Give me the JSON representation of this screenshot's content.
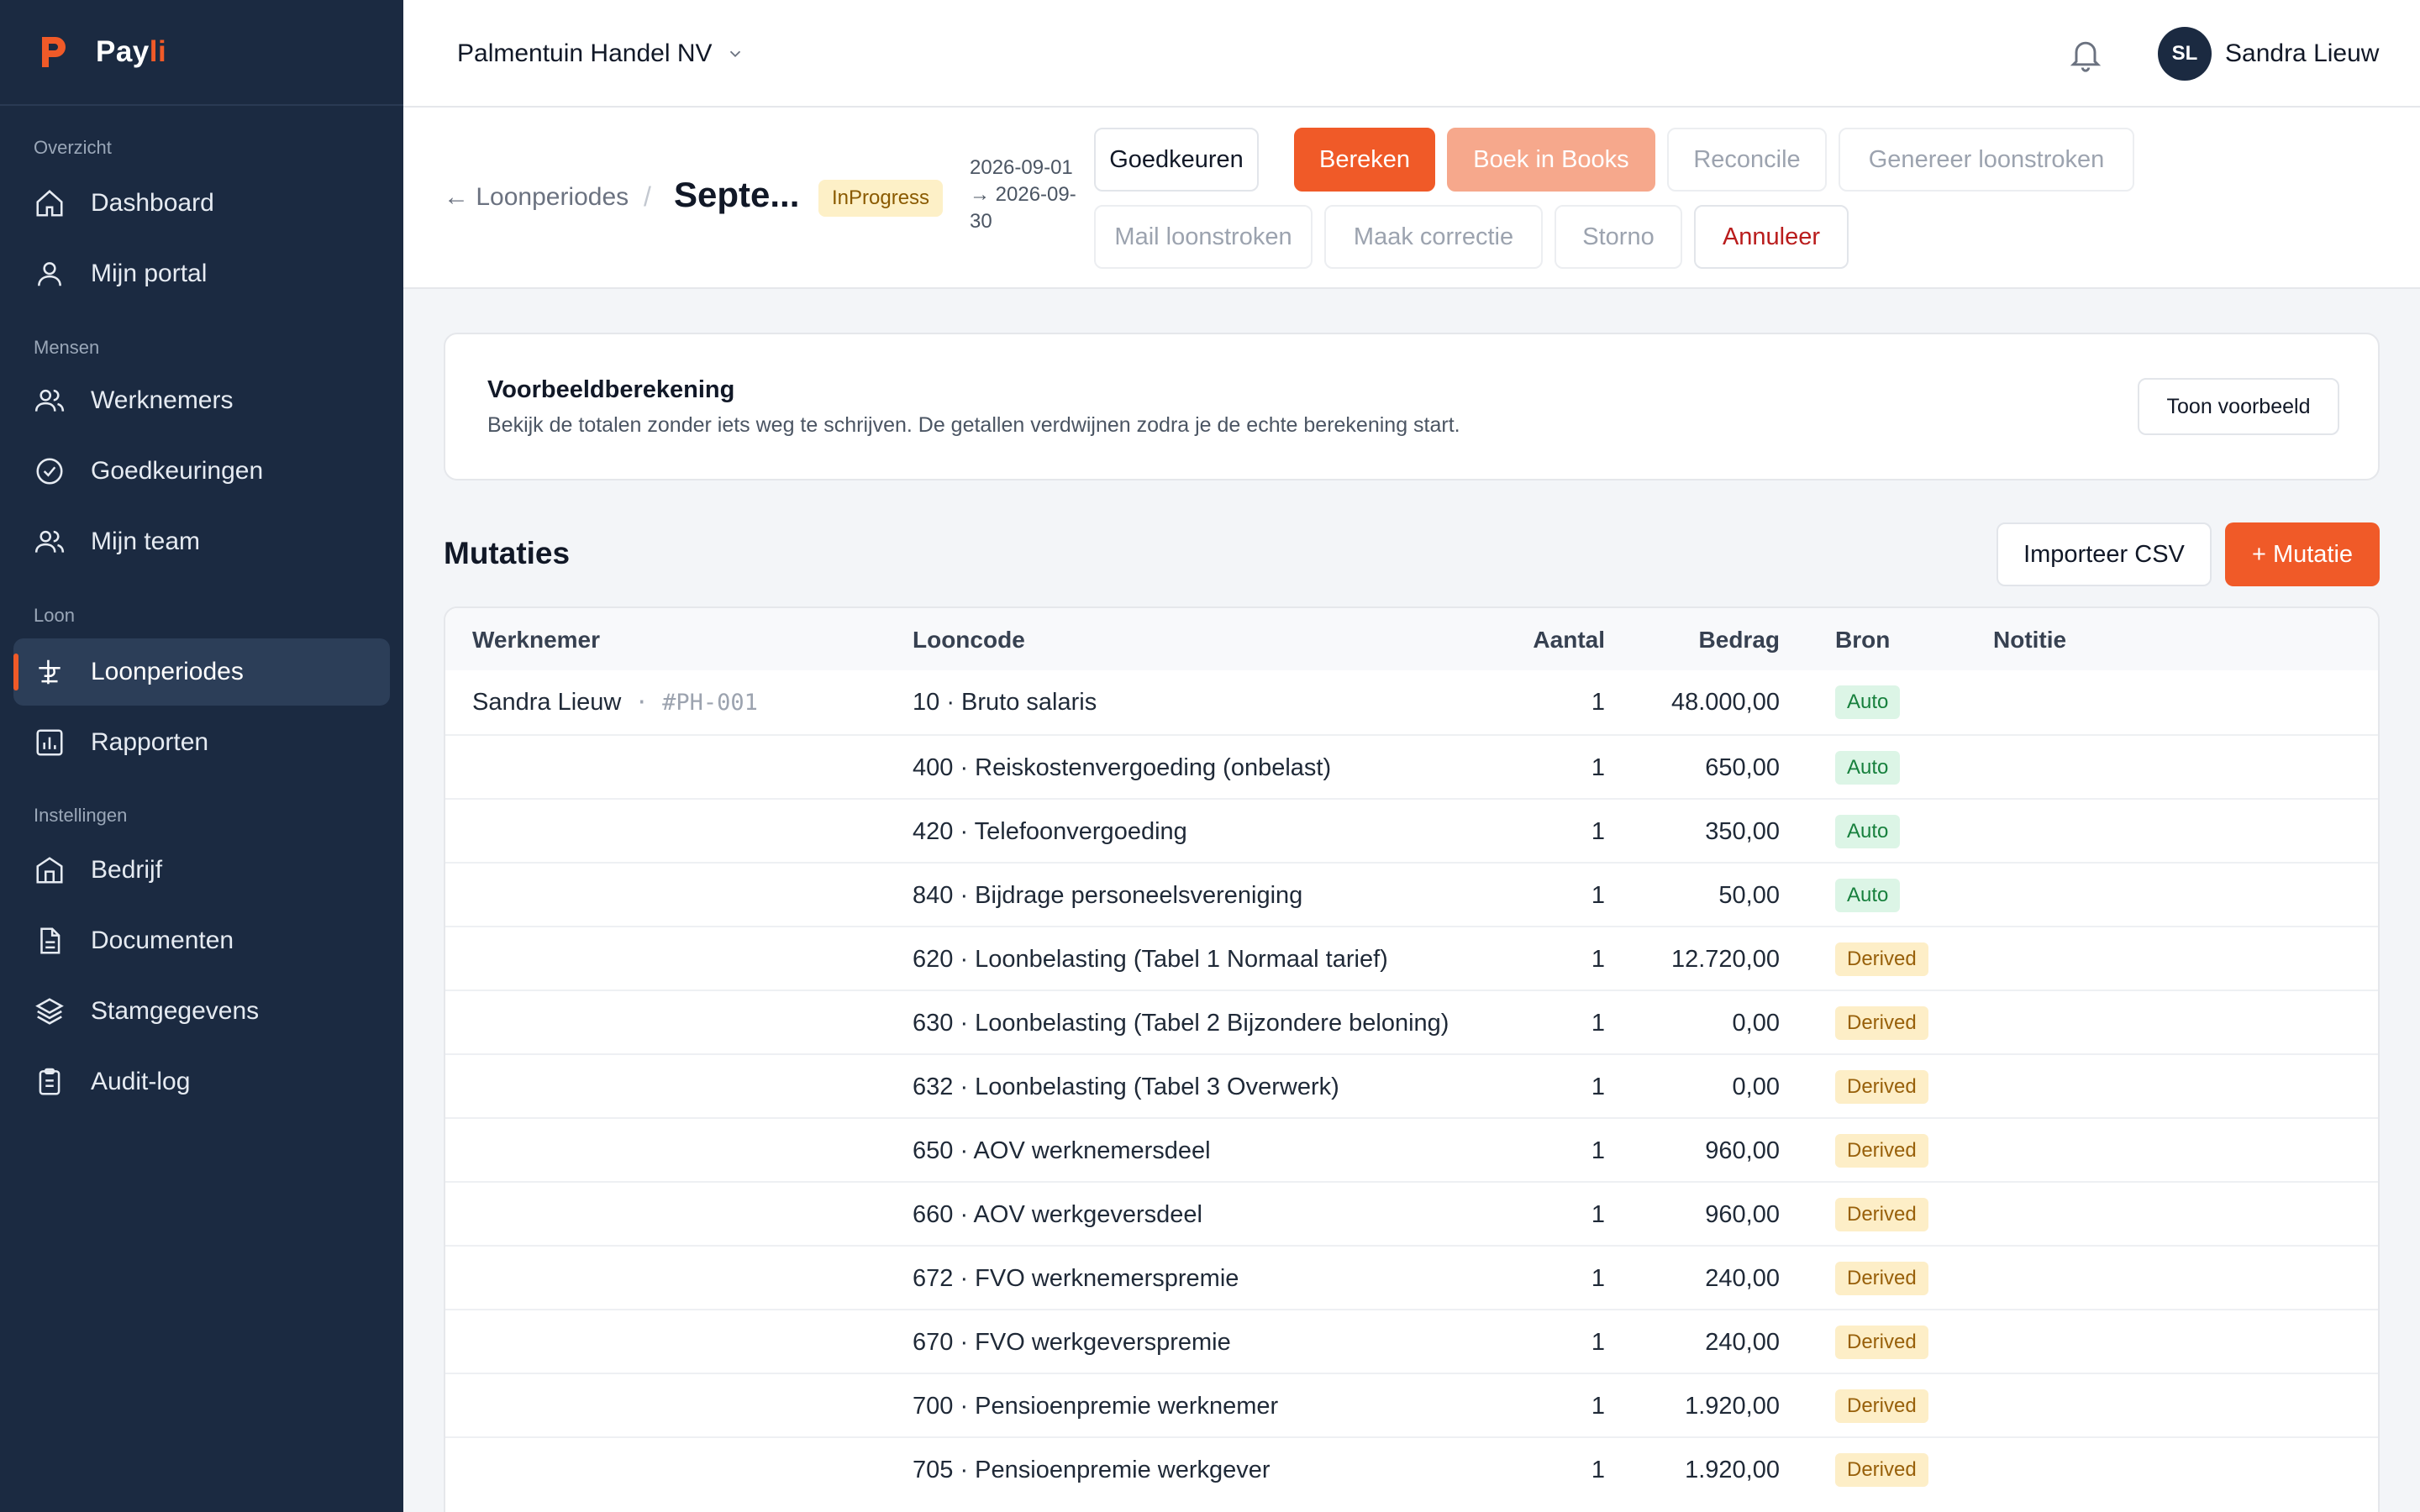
{
  "brand": {
    "name_main": "Pay",
    "name_accent": "li"
  },
  "sidebar": {
    "sections": [
      {
        "label": "Overzicht"
      },
      {
        "label": "Mensen"
      },
      {
        "label": "Loon"
      },
      {
        "label": "Instellingen"
      }
    ],
    "items": [
      {
        "label": "Dashboard",
        "icon": "home-icon"
      },
      {
        "label": "Mijn portal",
        "icon": "user-icon"
      },
      {
        "label": "Werknemers",
        "icon": "users-icon"
      },
      {
        "label": "Goedkeuringen",
        "icon": "check-circle-icon"
      },
      {
        "label": "Mijn team",
        "icon": "users-icon"
      },
      {
        "label": "Loonperiodes",
        "icon": "currency-icon",
        "active": true
      },
      {
        "label": "Rapporten",
        "icon": "bar-chart-icon"
      },
      {
        "label": "Bedrijf",
        "icon": "building-icon"
      },
      {
        "label": "Documenten",
        "icon": "document-icon"
      },
      {
        "label": "Stamgegevens",
        "icon": "layers-icon"
      },
      {
        "label": "Audit-log",
        "icon": "clipboard-icon"
      }
    ]
  },
  "topbar": {
    "org_name": "Palmentuin Handel NV",
    "user_initials": "SL",
    "user_name": "Sandra Lieuw"
  },
  "header": {
    "back_label": "← Loonperiodes",
    "separator": "/",
    "title": "Septe...",
    "status": "InProgress",
    "period_line1": "2026-09-01",
    "period_line2": "→ 2026-09-",
    "period_line3": "30",
    "actions": {
      "approve": "Goedkeuren",
      "calculate": "Bereken",
      "book": "Boek in Books",
      "reconcile": "Reconcile",
      "generate": "Genereer loonstroken",
      "mail": "Mail loonstroken",
      "correction": "Maak correctie",
      "storno": "Storno",
      "cancel": "Annuleer"
    }
  },
  "preview": {
    "title": "Voorbeeldberekening",
    "description": "Bekijk de totalen zonder iets weg te schrijven. De getallen verdwijnen zodra je de echte berekening start.",
    "button": "Toon voorbeeld"
  },
  "mutations": {
    "title": "Mutaties",
    "import_label": "Importeer CSV",
    "add_label": "+ Mutatie",
    "columns": {
      "employee": "Werknemer",
      "code": "Looncode",
      "qty": "Aantal",
      "amount": "Bedrag",
      "source": "Bron",
      "note": "Notitie"
    },
    "rows": [
      {
        "employee": "Sandra Lieuw",
        "employee_id": " · #PH-001",
        "code": "10 · Bruto salaris",
        "qty": "1",
        "amount": "48.000,00",
        "source": "Auto"
      },
      {
        "employee": "",
        "employee_id": "",
        "code": "400 · Reiskostenvergoeding (onbelast)",
        "qty": "1",
        "amount": "650,00",
        "source": "Auto"
      },
      {
        "employee": "",
        "employee_id": "",
        "code": "420 · Telefoonvergoeding",
        "qty": "1",
        "amount": "350,00",
        "source": "Auto"
      },
      {
        "employee": "",
        "employee_id": "",
        "code": "840 · Bijdrage personeelsvereniging",
        "qty": "1",
        "amount": "50,00",
        "source": "Auto"
      },
      {
        "employee": "",
        "employee_id": "",
        "code": "620 · Loonbelasting (Tabel 1 Normaal tarief)",
        "qty": "1",
        "amount": "12.720,00",
        "source": "Derived"
      },
      {
        "employee": "",
        "employee_id": "",
        "code": "630 · Loonbelasting (Tabel 2 Bijzondere beloning)",
        "qty": "1",
        "amount": "0,00",
        "source": "Derived"
      },
      {
        "employee": "",
        "employee_id": "",
        "code": "632 · Loonbelasting (Tabel 3 Overwerk)",
        "qty": "1",
        "amount": "0,00",
        "source": "Derived"
      },
      {
        "employee": "",
        "employee_id": "",
        "code": "650 · AOV werknemersdeel",
        "qty": "1",
        "amount": "960,00",
        "source": "Derived"
      },
      {
        "employee": "",
        "employee_id": "",
        "code": "660 · AOV werkgeversdeel",
        "qty": "1",
        "amount": "960,00",
        "source": "Derived"
      },
      {
        "employee": "",
        "employee_id": "",
        "code": "672 · FVO werknemerspremie",
        "qty": "1",
        "amount": "240,00",
        "source": "Derived"
      },
      {
        "employee": "",
        "employee_id": "",
        "code": "670 · FVO werkgeverspremie",
        "qty": "1",
        "amount": "240,00",
        "source": "Derived"
      },
      {
        "employee": "",
        "employee_id": "",
        "code": "700 · Pensioenpremie werknemer",
        "qty": "1",
        "amount": "1.920,00",
        "source": "Derived"
      },
      {
        "employee": "",
        "employee_id": "",
        "code": "705 · Pensioenpremie werkgever",
        "qty": "1",
        "amount": "1.920,00",
        "source": "Derived"
      }
    ]
  },
  "colors": {
    "accent": "#f05a28",
    "sidebar_bg": "#1b2a41"
  }
}
